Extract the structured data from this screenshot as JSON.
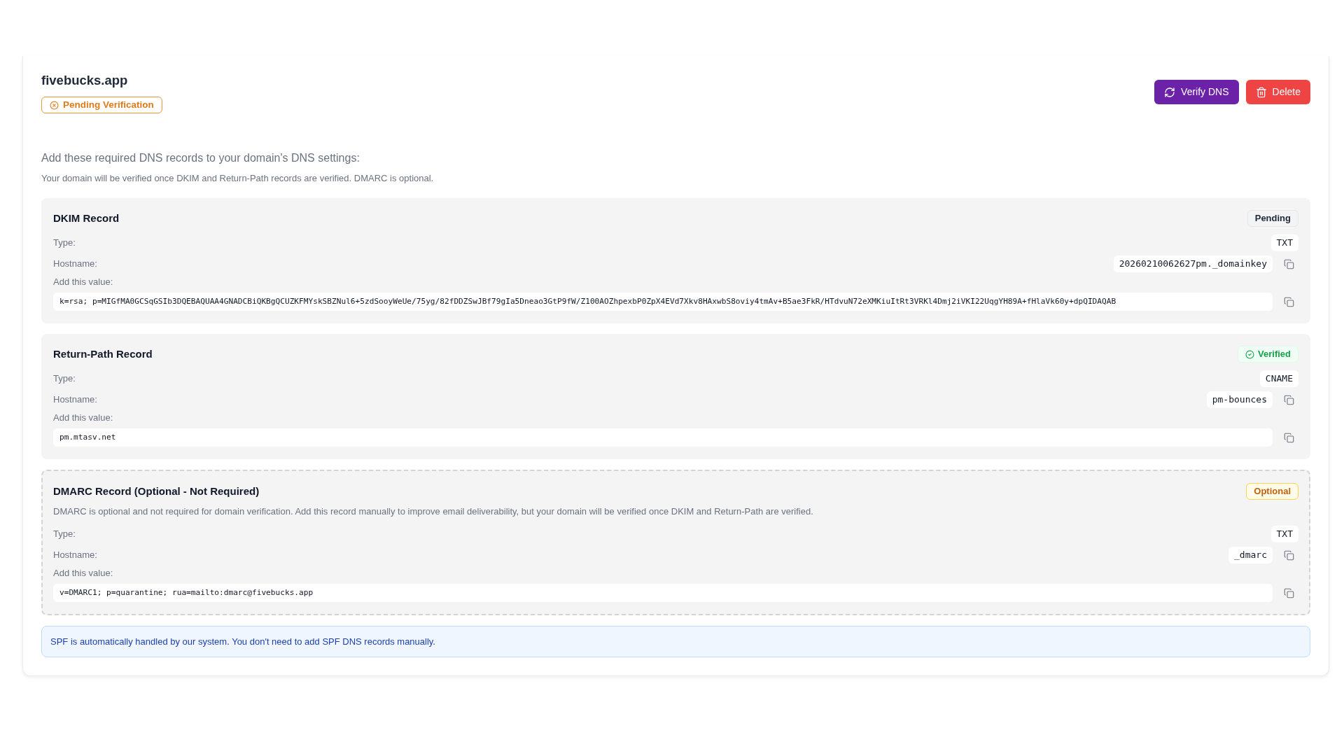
{
  "domain": {
    "name": "fivebucks.app",
    "status": {
      "label": "Pending Verification",
      "kind": "pending"
    }
  },
  "actions": [
    {
      "label": "Verify DNS",
      "kind": "verify"
    },
    {
      "label": "Delete",
      "kind": "delete"
    }
  ],
  "intro": {
    "heading": "Add these required DNS records to your domain's DNS settings:",
    "note": "Your domain will be verified once DKIM and Return-Path records are verified. DMARC is optional."
  },
  "records": [
    {
      "title": "DKIM Record",
      "optional": false,
      "status": {
        "label": "Pending",
        "kind": "pending"
      },
      "fields": [
        {
          "kind": "type",
          "label": "Type:",
          "value": "TXT"
        },
        {
          "kind": "hostname",
          "label": "Hostname:",
          "value": "20260210062627pm._domainkey"
        }
      ],
      "value_label": "Add this value:",
      "value": "k=rsa; p=MIGfMA0GCSqGSIb3DQEBAQUAA4GNADCBiQKBgQCUZKFMYskSBZNul6+5zdSooyWeUe/75yg/82fDDZSwJBf79gIa5Dneao3GtP9fW/Z100AOZhpexbP0ZpX4EVd7Xkv8HAxwbS8oviy4tmAv+B5ae3FkR/HTdvuN72eXMKiuItRt3VRKl4Dmj2iVKI22UqgYH89A+fHlaVk60y+dpQIDAQAB"
    },
    {
      "title": "Return-Path Record",
      "optional": false,
      "status": {
        "label": "Verified",
        "kind": "verified"
      },
      "fields": [
        {
          "kind": "type",
          "label": "Type:",
          "value": "CNAME"
        },
        {
          "kind": "hostname",
          "label": "Hostname:",
          "value": "pm-bounces"
        }
      ],
      "value_label": "Add this value:",
      "value": "pm.mtasv.net"
    },
    {
      "title": "DMARC Record (Optional - Not Required)",
      "optional": true,
      "status": {
        "label": "Optional",
        "kind": "optional"
      },
      "description": "DMARC is optional and not required for domain verification. Add this record manually to improve email deliverability, but your domain will be verified once DKIM and Return-Path are verified.",
      "fields": [
        {
          "kind": "type",
          "label": "Type:",
          "value": "TXT"
        },
        {
          "kind": "hostname",
          "label": "Hostname:",
          "value": "_dmarc"
        }
      ],
      "value_label": "Add this value:",
      "value": "v=DMARC1; p=quarantine; rua=mailto:dmarc@fivebucks.app"
    }
  ],
  "info_banner": "SPF is automatically handled by our system. You don't need to add SPF DNS records manually."
}
